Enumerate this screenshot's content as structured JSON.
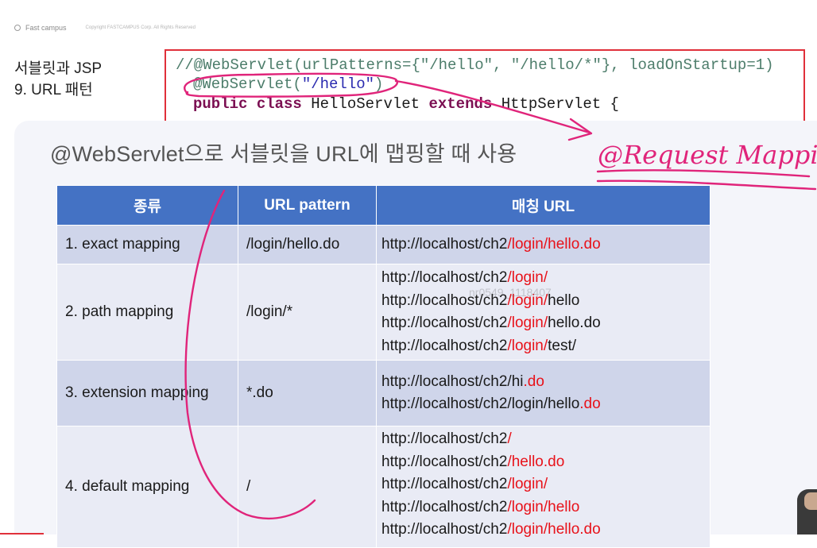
{
  "brand": {
    "name": "Fast campus",
    "copyright": "Copyright FASTCAMPUS Corp. All Rights Reserved"
  },
  "lesson": {
    "line1": "서블릿과 JSP",
    "line2": "9. URL 패턴"
  },
  "code": {
    "line1": "//@WebServlet(urlPatterns={\"/hello\", \"/hello/*\"}, loadOnStartup=1)",
    "line2_pre": "@WebServlet(",
    "line2_str": "\"/hello\"",
    "line2_post": ")",
    "line3_kw1": "public class",
    "line3_mid": " HelloServlet ",
    "line3_kw2": "extends",
    "line3_post": " HttpServlet {"
  },
  "heading": "@WebServlet으로 서블릿을 URL에 맵핑할 때 사용",
  "annotation": "@Request Mapping",
  "watermark": "nr0549_1118407",
  "table": {
    "headers": [
      "종류",
      "URL pattern",
      "매칭 URL"
    ],
    "rows": [
      {
        "type": "1. exact mapping",
        "pattern": "/login/hello.do",
        "urls": [
          {
            "base": "http://localhost/ch2",
            "red": "/login/hello.do",
            "tail": ""
          }
        ]
      },
      {
        "type": "2. path mapping",
        "pattern": "/login/*",
        "urls": [
          {
            "base": "http://localhost/ch2",
            "red": "/login/",
            "tail": ""
          },
          {
            "base": "http://localhost/ch2",
            "red": "/login/",
            "tail": "hello"
          },
          {
            "base": "http://localhost/ch2",
            "red": "/login/",
            "tail": "hello.do"
          },
          {
            "base": "http://localhost/ch2",
            "red": "/login/",
            "tail": "test/"
          }
        ]
      },
      {
        "type": "3. extension mapping",
        "pattern": "*.do",
        "urls": [
          {
            "base": "http://localhost/ch2/hi",
            "red": ".do",
            "tail": ""
          },
          {
            "base": "http://localhost/ch2/login/hello",
            "red": ".do",
            "tail": ""
          }
        ]
      },
      {
        "type": "4. default mapping",
        "pattern": "/",
        "urls": [
          {
            "base": "http://localhost/ch2",
            "red": "/",
            "tail": ""
          },
          {
            "base": "http://localhost/ch2",
            "red": "/hello.do",
            "tail": ""
          },
          {
            "base": "http://localhost/ch2",
            "red": "/login/",
            "tail": ""
          },
          {
            "base": "http://localhost/ch2",
            "red": "/login/hello",
            "tail": ""
          },
          {
            "base": "http://localhost/ch2",
            "red": "/login/hello.do",
            "tail": ""
          }
        ]
      }
    ]
  },
  "colors": {
    "header_bg": "#4472c4",
    "row_dark": "#cfd5ea",
    "row_light": "#e9ebf5",
    "highlight_red": "#e8121a",
    "ink_pink": "#e0247a",
    "box_red": "#e0303a"
  }
}
